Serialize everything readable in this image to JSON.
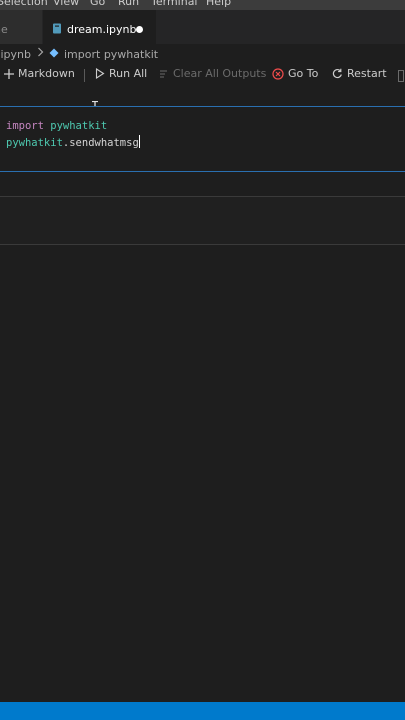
{
  "menu": {
    "items": [
      "Selection",
      "View",
      "Go",
      "Run",
      "Terminal",
      "Help"
    ]
  },
  "tabs": {
    "inactive_label": "ne",
    "active_label": "dream.ipynb"
  },
  "breadcrumb": {
    "file": ".ipynb",
    "symbol": "import pywhatkit"
  },
  "toolbar": {
    "markdown_label": "Markdown",
    "run_all_label": "Run All",
    "clear_all_outputs_label": "Clear All Outputs",
    "go_to_label": "Go To",
    "restart_label": "Restart"
  },
  "cell": {
    "line1_keyword": "import",
    "line1_module": "pywhatkit",
    "line2_object": "pywhatkit",
    "line2_dot": ".",
    "line2_member": "sendwhatmsg"
  },
  "colors": {
    "accent": "#007acc",
    "cell_border": "#2a6fb0",
    "keyword": "#c586c0",
    "module": "#4ec9b0",
    "go_to_icon": "#f14c4c"
  },
  "icons": {
    "tab": "notebook-icon",
    "breadcrumb_separator": "chevron-right-icon",
    "symbol": "cube-icon",
    "markdown": "plus-icon",
    "run_all": "play-icon",
    "clear": "clear-all-icon",
    "go_to": "error-circle-icon",
    "restart": "restart-icon"
  }
}
